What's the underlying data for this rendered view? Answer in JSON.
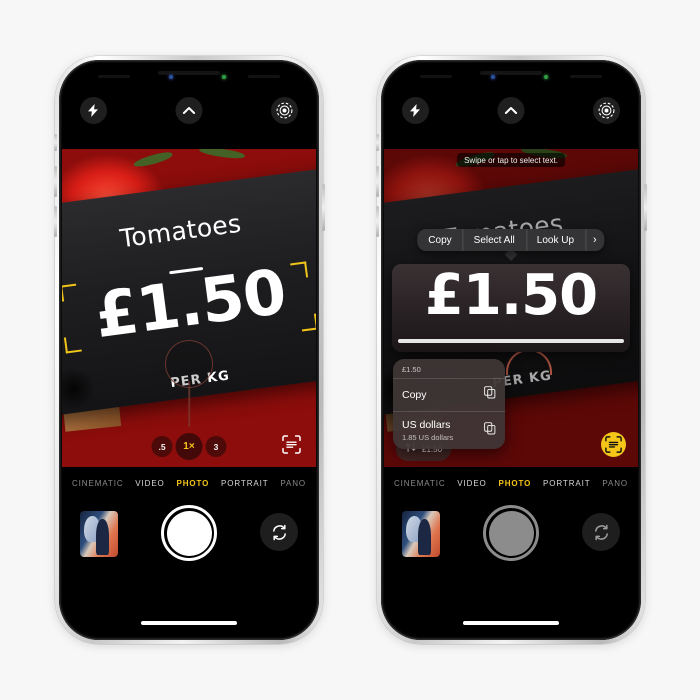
{
  "background_color": "#f7f7f7",
  "phones": [
    {
      "id": "left",
      "label": "iphone-camera-live-text-detection",
      "top_controls": {
        "flash": "flash-icon",
        "chevron": "chevron-up-icon",
        "live_photo": "live-photo-icon"
      },
      "scene": {
        "sign_title": "Tomatoes",
        "sign_price": "£1.50",
        "sign_per": "PER KG",
        "detected_text": "£1.50",
        "detection_bracket_color": "#f0c419"
      },
      "zoom_levels": [
        {
          "label": ".5",
          "active": false
        },
        {
          "label": "1×",
          "active": true
        },
        {
          "label": "3",
          "active": false
        }
      ],
      "live_text_button": {
        "icon": "live-text-icon",
        "active": false
      },
      "modes": [
        {
          "label": "CINEMATIC",
          "active": false
        },
        {
          "label": "VIDEO",
          "active": false
        },
        {
          "label": "PHOTO",
          "active": true
        },
        {
          "label": "PORTRAIT",
          "active": false
        },
        {
          "label": "PANO",
          "active": false
        }
      ],
      "shutter": {
        "name": "shutter-button",
        "dimmed": false
      },
      "thumbnail": "photo-library-thumbnail",
      "flip_camera": "flip-camera-icon"
    },
    {
      "id": "right",
      "label": "iphone-camera-text-selected-currency-conversion",
      "top_controls": {
        "flash": "flash-icon",
        "chevron": "chevron-up-icon",
        "live_photo": "live-photo-icon"
      },
      "hint_toast": "Swipe or tap to select text.",
      "edit_menu": [
        {
          "label": "Copy"
        },
        {
          "label": "Select All"
        },
        {
          "label": "Look Up"
        },
        {
          "label": "›"
        }
      ],
      "loupe": {
        "text": "£1.50"
      },
      "scene": {
        "sign_title": "Tomatoes",
        "sign_price": "£1.50",
        "sign_per": "PER KG"
      },
      "conversion_sheet": {
        "header": "£1.50",
        "rows": [
          {
            "title": "Copy",
            "subtitle": "",
            "action_icon": "copy-icon"
          },
          {
            "title": "US dollars",
            "subtitle": "1.85 US dollars",
            "action_icon": "copy-icon"
          }
        ]
      },
      "currency_pill": {
        "icon": "currency-convert-icon",
        "label": "£1.50"
      },
      "live_text_button": {
        "icon": "live-text-icon",
        "active": true,
        "color": "#f5c518"
      },
      "modes": [
        {
          "label": "CINEMATIC",
          "active": false
        },
        {
          "label": "VIDEO",
          "active": false
        },
        {
          "label": "PHOTO",
          "active": true
        },
        {
          "label": "PORTRAIT",
          "active": false
        },
        {
          "label": "PANO",
          "active": false
        }
      ],
      "shutter": {
        "name": "shutter-button",
        "dimmed": true
      },
      "thumbnail": "photo-library-thumbnail",
      "flip_camera": "flip-camera-icon"
    }
  ]
}
